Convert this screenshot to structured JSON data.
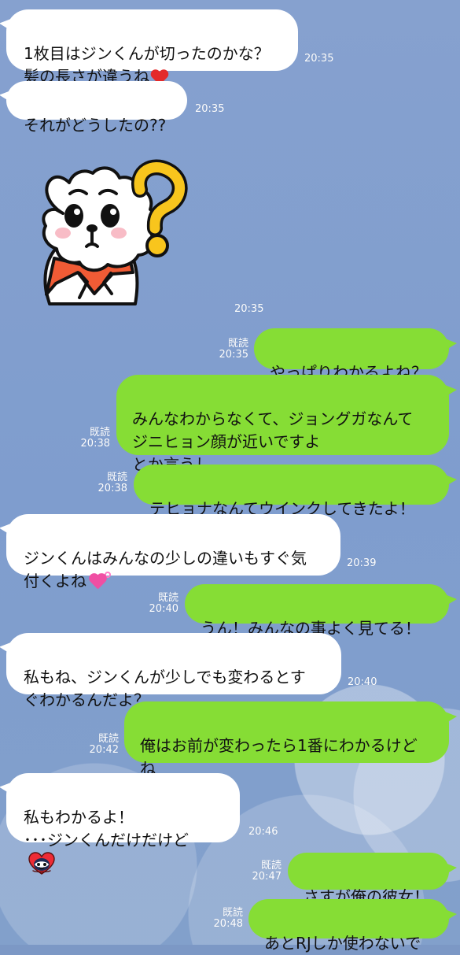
{
  "messages": [
    {
      "text": "1枚目はジンくんが切ったのかな？\n髪の長さが違うね",
      "time": "20:35"
    },
    {
      "text": "それがどうしたの??",
      "time": "20:35"
    },
    {
      "time": "20:35"
    },
    {
      "read": "既読",
      "time": "20:35",
      "text": "やっぱりわかるよね？"
    },
    {
      "read": "既読",
      "time": "20:38",
      "text": "みんなわからなくて、ジョングガなんて\nジニヒョン顔が近いですよ\nとか言うし"
    },
    {
      "read": "既読",
      "time": "20:38",
      "text": "テヒョナなんてウインクしてきたよ！"
    },
    {
      "text": "ジンくんはみんなの少しの違いもすぐ気\n付くよね",
      "time": "20:39"
    },
    {
      "read": "既読",
      "time": "20:40",
      "text": "うん！みんなの事よく見てる！"
    },
    {
      "text": "私もね、ジンくんが少しでも変わるとす\nぐわかるんだよ？",
      "time": "20:40"
    },
    {
      "read": "既読",
      "time": "20:42",
      "text": "俺はお前が変わったら1番にわかるけど\nね"
    },
    {
      "text": "私もわかるよ！\n･･･ジンくんだけだけど",
      "time": "20:46"
    },
    {
      "read": "既読",
      "time": "20:47",
      "text": "さすが俺の彼女！"
    },
    {
      "read": "既読",
      "time": "20:48",
      "text": "あとRJしか使わないで"
    }
  ],
  "colors": {
    "background": "#7f9dce",
    "incoming_bubble": "#ffffff",
    "outgoing_bubble": "#86dd35",
    "meta_text": "#ffffff"
  },
  "icons": {
    "heart": "red-heart-icon",
    "pink_heart": "pink-heart-icon",
    "tata": "tata-heart-icon",
    "sticker": "rj-question-sticker-icon"
  }
}
